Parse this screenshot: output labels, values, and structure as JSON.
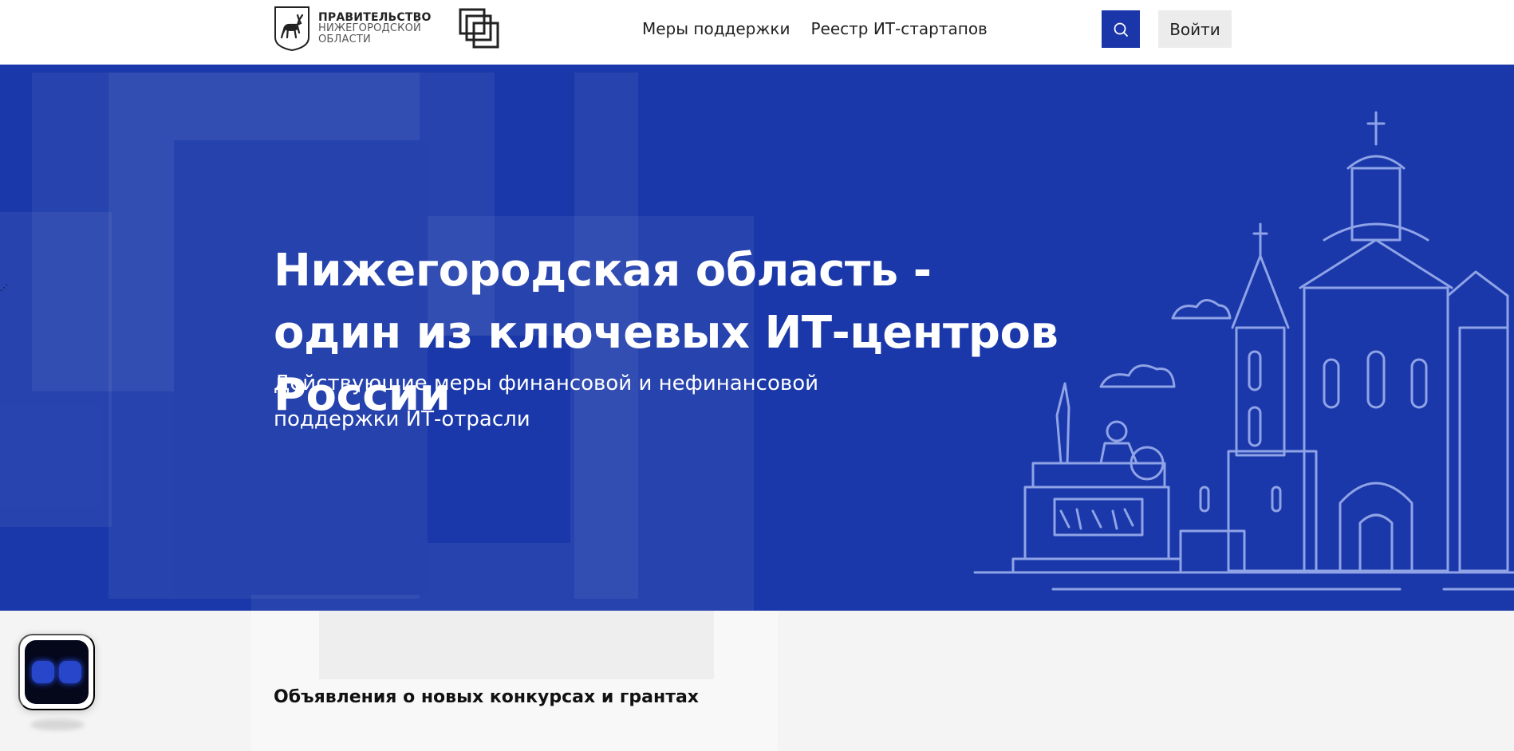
{
  "header": {
    "gov_logo": {
      "line1": "ПРАВИТЕЛЬСТВО",
      "line2": "НИЖЕГОРОДСКОЙ",
      "line3": "ОБЛАСТИ"
    },
    "nav": [
      {
        "label": "Меры поддержки"
      },
      {
        "label": "Реестр ИТ-стартапов"
      }
    ],
    "search_icon": "search-icon",
    "login_label": "Войти"
  },
  "hero": {
    "title": "Нижегородская область - один из ключевых ИТ-центров России",
    "subtitle": "Действующие меры финансовой и нефинансовой поддержки ИТ-отрасли"
  },
  "section": {
    "title": "Объявления о новых конкурсах и грантах"
  },
  "colors": {
    "primary_blue": "#1a38a9",
    "search_button": "#1b36a8",
    "login_button_bg": "#ececec",
    "lower_bg": "#f4f4f4"
  }
}
